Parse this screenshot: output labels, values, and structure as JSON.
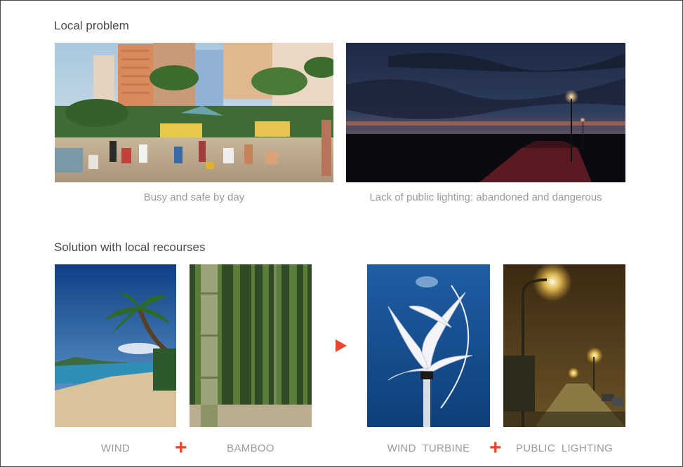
{
  "problem": {
    "title": "Local problem",
    "captions": [
      "Busy and safe by day",
      "Lack of public lighting: abandoned and dangerous"
    ]
  },
  "solution": {
    "title": "Solution with local recourses",
    "labels": [
      "WIND",
      "BAMBOO",
      "WIND  TURBINE",
      "PUBLIC  LIGHTING"
    ],
    "plus_symbol": "+"
  },
  "colors": {
    "accent": "#e8452c",
    "caption": "#9a9a9a",
    "title": "#4b4b4b"
  }
}
